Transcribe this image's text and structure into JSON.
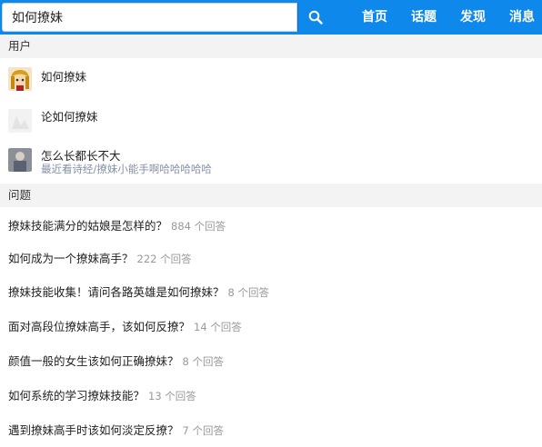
{
  "search": {
    "value": "如何撩妹",
    "placeholder": ""
  },
  "nav": [
    "首页",
    "话题",
    "发现",
    "消息"
  ],
  "sections": {
    "users_label": "用户",
    "questions_label": "问题"
  },
  "users": [
    {
      "name": "如何撩妹",
      "desc": ""
    },
    {
      "name": "论如何撩妹",
      "desc": ""
    },
    {
      "name": "怎么长都长不大",
      "desc": "最近看诗经/撩妹小能手啊哈哈哈哈哈"
    }
  ],
  "questions": [
    {
      "title": "撩妹技能满分的姑娘是怎样的？",
      "count": "884 个回答"
    },
    {
      "title": "如何成为一个撩妹高手？",
      "count": "222 个回答"
    },
    {
      "title": "撩妹技能收集！请问各路英雄是如何撩妹？",
      "count": "8 个回答"
    },
    {
      "title": "面对高段位撩妹高手，该如何反撩？",
      "count": "14 个回答"
    },
    {
      "title": "颜值一般的女生该如何正确撩妹？",
      "count": "8 个回答"
    },
    {
      "title": "如何系统的学习撩妹技能？",
      "count": "13 个回答"
    },
    {
      "title": "遇到撩妹高手时该如何淡定反撩？",
      "count": "7 个回答"
    }
  ],
  "colors": {
    "brand": "#0f88eb",
    "section_bg": "#f3f3f3",
    "muted": "#999999"
  }
}
